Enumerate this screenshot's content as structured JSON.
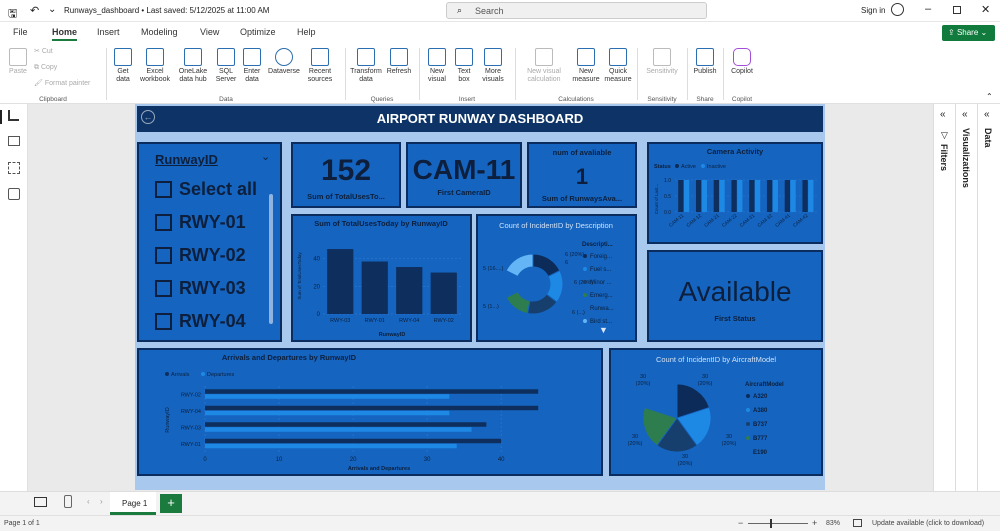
{
  "titlebar": {
    "title": "Runways_dashboard • Last saved: 5/12/2025 at 11:00 AM",
    "search_placeholder": "Search",
    "signin": "Sign in"
  },
  "menu": {
    "items": [
      "File",
      "Home",
      "Insert",
      "Modeling",
      "View",
      "Optimize",
      "Help"
    ],
    "share": "Share"
  },
  "ribbon": {
    "clipboard": {
      "paste": "Paste",
      "cut": "Cut",
      "copy": "Copy",
      "format_painter": "Format painter",
      "label": "Clipboard"
    },
    "data": {
      "get_data": "Get data",
      "excel": "Excel workbook",
      "onelake": "OneLake data hub",
      "sql": "SQL Server",
      "enter": "Enter data",
      "dataverse": "Dataverse",
      "recent": "Recent sources",
      "label": "Data"
    },
    "queries": {
      "transform": "Transform data",
      "refresh": "Refresh",
      "label": "Queries"
    },
    "insert": {
      "new_visual": "New visual",
      "text_box": "Text box",
      "more_visuals": "More visuals",
      "label": "Insert"
    },
    "calc": {
      "new_visual_calc": "New visual calculation",
      "new_measure": "New measure",
      "quick_measure": "Quick measure",
      "label": "Calculations"
    },
    "sensitivity": {
      "btn": "Sensitivity",
      "label": "Sensitivity"
    },
    "share": {
      "publish": "Publish",
      "label": "Share"
    },
    "copilot": {
      "btn": "Copilot",
      "label": "Copilot"
    }
  },
  "panes": {
    "filters": "Filters",
    "visualizations": "Visualizations",
    "data": "Data"
  },
  "report": {
    "title": "AIRPORT RUNWAY DASHBOARD",
    "slicer": {
      "title": "RunwayID",
      "items": [
        "Select all",
        "RWY-01",
        "RWY-02",
        "RWY-03",
        "RWY-04"
      ]
    },
    "card_total": {
      "value": "152",
      "label": "Sum of TotalUsesTo..."
    },
    "card_camera": {
      "value": "CAM-11",
      "label": "First CameraID"
    },
    "card_available": {
      "title": "num of avaliable",
      "value": "1",
      "label": "Sum of RunwaysAva..."
    },
    "card_status": {
      "value": "Available",
      "label": "First Status"
    }
  },
  "camera_activity": {
    "title": "Camera Activity",
    "legend_title": "Status",
    "legend": [
      "Active",
      "Inactive"
    ],
    "ylabel": "Count of Last...",
    "ticks": [
      "0.0",
      "0.5",
      "1.0"
    ]
  },
  "chart_data": [
    {
      "type": "bar",
      "title": "Sum of TotalUsesToday by RunwayID",
      "categories": [
        "RWY-03",
        "RWY-01",
        "RWY-04",
        "RWY-02"
      ],
      "values": [
        47,
        38,
        34,
        30
      ],
      "xlabel": "RunwayID",
      "ylabel": "Sum of TotalUsesToday",
      "yticks": [
        0,
        20,
        40
      ],
      "ylim": [
        0,
        55
      ]
    },
    {
      "type": "pie",
      "title": "Count of IncidentID by Description",
      "donut": true,
      "legend_title": "Descripti...",
      "categories": [
        "Foreig...",
        "Fuel s...",
        "Minor ...",
        "Emerg...",
        "Runwa...",
        "Bird st..."
      ],
      "values": [
        6,
        6,
        6,
        5,
        5,
        6
      ],
      "colors": [
        "#0d2b59",
        "#1e88e5",
        "#173f6e",
        "#2e7d4f",
        "#1565c0",
        "#64b5f6"
      ],
      "data_labels": [
        "6 (20%)",
        "6",
        "6 (20%)",
        "5 (1...)",
        "5 (16....)",
        "6 (...)"
      ]
    },
    {
      "type": "bar",
      "title": "Arrivals and Departures by RunwayID",
      "orientation": "horizontal",
      "legend": [
        "Arrivals",
        "Departures"
      ],
      "categories": [
        "RWY-02",
        "RWY-04",
        "RWY-03",
        "RWY-01"
      ],
      "series": [
        {
          "name": "Arrivals",
          "values": [
            45,
            45,
            38,
            40
          ]
        },
        {
          "name": "Departures",
          "values": [
            33,
            33,
            36,
            34
          ]
        }
      ],
      "xlabel": "Arrivals and Departures",
      "ylabel": "RunwayID",
      "xticks": [
        0,
        10,
        20,
        30,
        40
      ],
      "xlim": [
        0,
        47
      ]
    },
    {
      "type": "pie",
      "title": "Count of IncidentID by AircraftModel",
      "legend_title": "AircraftModel",
      "categories": [
        "A320",
        "A380",
        "B737",
        "B777",
        "E190"
      ],
      "values": [
        30,
        30,
        30,
        30,
        30
      ],
      "colors": [
        "#0d2b59",
        "#1e88e5",
        "#173f6e",
        "#2e7d4f",
        "#1565c0"
      ],
      "data_labels": [
        "30 (20%)",
        "30 (20%)",
        "30 (20%)",
        "30 (20%)",
        "30 (20%)"
      ]
    },
    {
      "type": "bar",
      "title": "Camera Activity",
      "categories": [
        "CAM-11",
        "CAM-12",
        "CAM-21",
        "CAM-22",
        "CAM-31",
        "CAM-32",
        "CAM-41",
        "CAM-42"
      ],
      "series": [
        {
          "name": "Active",
          "values": [
            1,
            1,
            1,
            1,
            1,
            1,
            1,
            1
          ]
        },
        {
          "name": "Inactive",
          "values": [
            1,
            1,
            1,
            1,
            1,
            1,
            1,
            1
          ]
        }
      ],
      "ylim": [
        0,
        1
      ]
    }
  ],
  "tabs": {
    "page": "Page 1",
    "add": "+"
  },
  "status": {
    "page": "Page 1 of 1",
    "zoom": "83%",
    "update": "Update available (click to download)"
  }
}
